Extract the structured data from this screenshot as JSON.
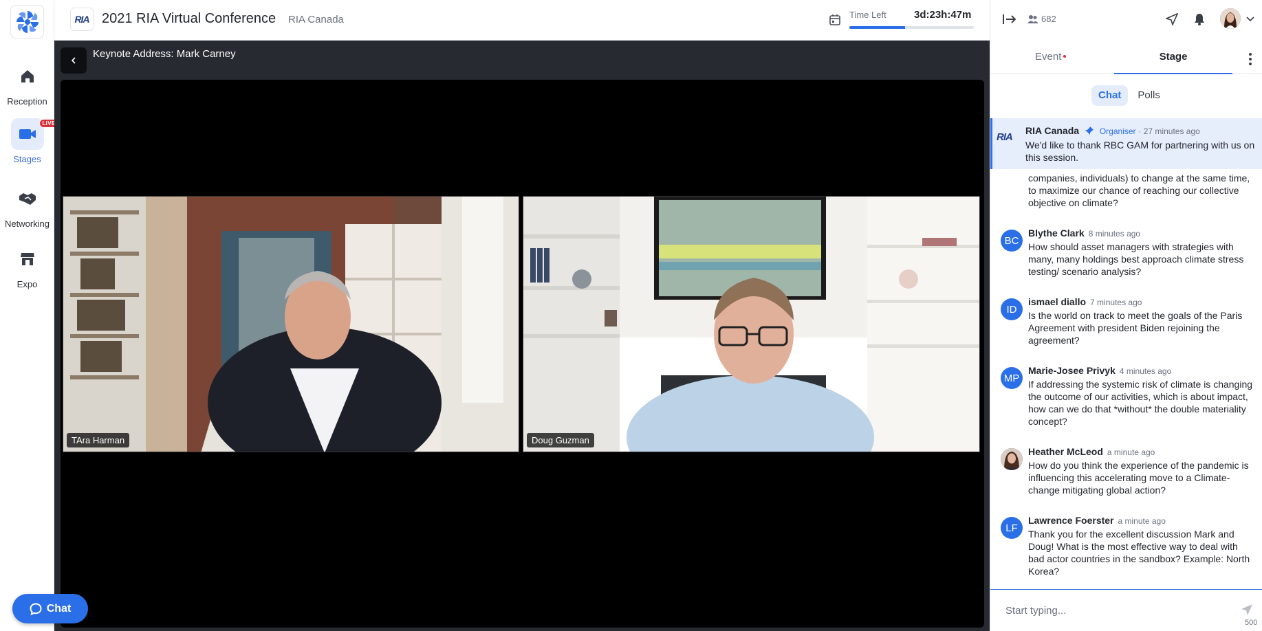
{
  "nav": {
    "items": [
      {
        "label": "Reception",
        "icon": "home-icon"
      },
      {
        "label": "Stages",
        "icon": "video-camera-icon",
        "badge": "LIVE"
      },
      {
        "label": "Networking",
        "icon": "handshake-icon"
      },
      {
        "label": "Expo",
        "icon": "booth-icon"
      }
    ],
    "chat_button": "Chat"
  },
  "header": {
    "conference_logo": "RIA",
    "title": "2021 RIA Virtual Conference",
    "organizer": "RIA Canada",
    "time_left_label": "Time Left",
    "time_left_value": "3d:23h:47m",
    "time_progress": 0.45
  },
  "stage": {
    "session_title": "Keynote Address: Mark Carney",
    "participants": [
      {
        "name": "TAra Harman"
      },
      {
        "name": "Doug Guzman"
      }
    ]
  },
  "panel": {
    "attendee_count": "682",
    "tabs": {
      "event": "Event",
      "stage": "Stage"
    },
    "subtabs": {
      "chat": "Chat",
      "polls": "Polls"
    },
    "pinned": {
      "author": "RIA Canada",
      "role": "Organiser",
      "time": "· 27 minutes ago",
      "text": "We'd like to thank RBC GAM for partnering with us on this session."
    },
    "cutoff_text": "companies, individuals) to change at the same time, to maximize our chance of reaching our collective objective on climate?",
    "messages": [
      {
        "initials": "BC",
        "author": "Blythe Clark",
        "time": "8 minutes ago",
        "text": "How should asset managers with strategies with many, many holdings best approach climate stress testing/ scenario analysis?"
      },
      {
        "initials": "ID",
        "author": "ismael diallo",
        "time": "7 minutes ago",
        "text": "Is the world on track to meet the goals of the Paris Agreement with president Biden rejoining the agreement?"
      },
      {
        "initials": "MP",
        "author": "Marie-Josee Privyk",
        "time": "4 minutes ago",
        "text": "If addressing the systemic risk of climate is changing the outcome of our activities, which is about impact, how can we do that *without* the double materiality concept?"
      },
      {
        "initials": "",
        "author": "Heather McLeod",
        "time": "a minute ago",
        "text": "How do you think the experience of the pandemic is influencing this accelerating move to a Climate-change mitigating global action?"
      },
      {
        "initials": "LF",
        "author": "Lawrence Foerster",
        "time": "a minute ago",
        "text": "Thank you for the excellent discussion Mark and Doug! What is the most effective way to deal with bad actor countries in the sandbox? Example: North Korea?"
      }
    ],
    "composer": {
      "placeholder": "Start typing...",
      "char_limit": "500"
    }
  }
}
